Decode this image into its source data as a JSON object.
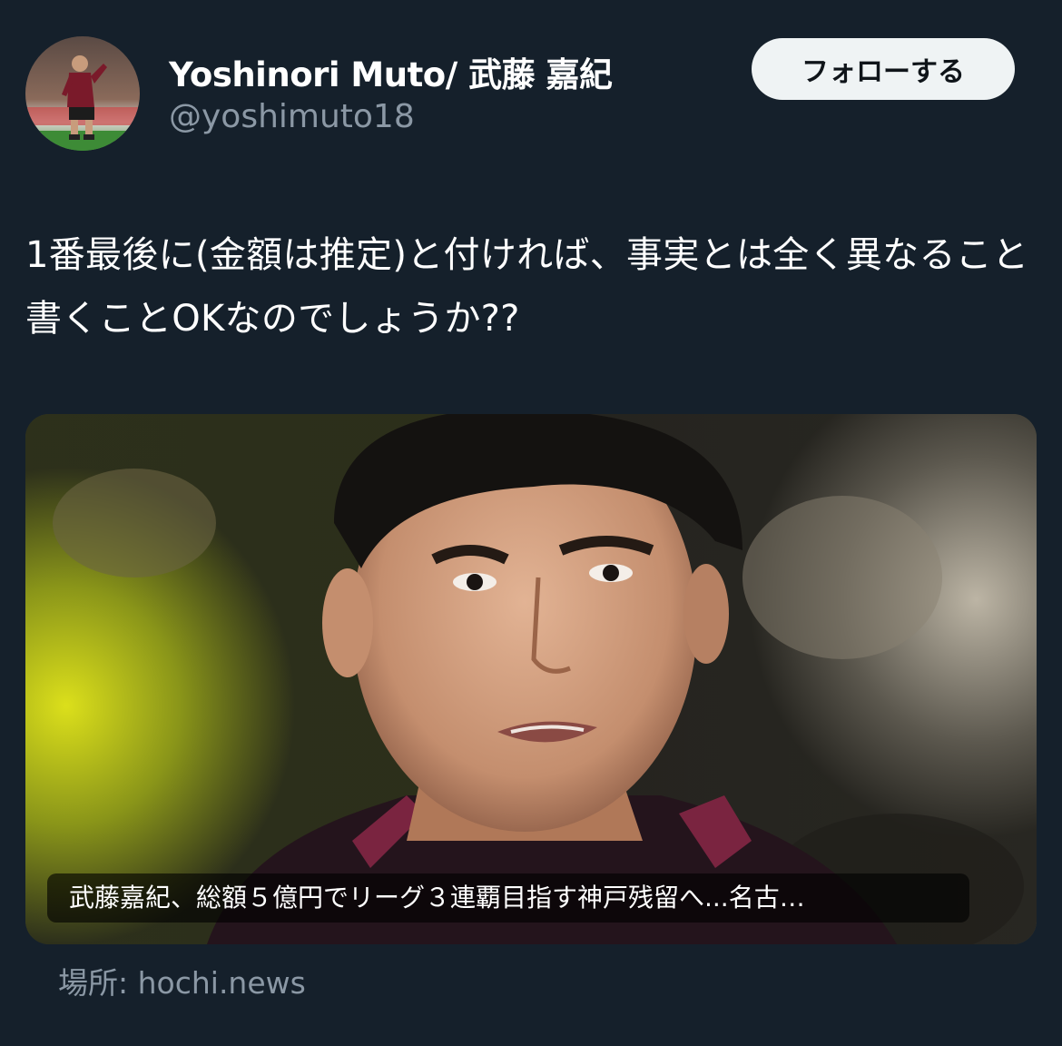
{
  "user": {
    "display_name": "Yoshinori Muto/ 武藤 嘉紀",
    "handle": "@yoshimuto18",
    "follow_label": "フォローする"
  },
  "tweet": {
    "text": "1番最後に(金額は推定)と付ければ、事実とは全く異なること書くことOKなのでしょうか??"
  },
  "card": {
    "caption": "武藤嘉紀、総額５億円でリーグ３連覇目指す神戸残留へ...名古…",
    "source": "場所: hochi.news"
  },
  "colors": {
    "background": "#15202b",
    "secondary_text": "#8b98a5",
    "follow_button_bg": "#eff3f4",
    "follow_button_text": "#0f1419"
  },
  "icons": {
    "avatar": "profile-photo-avatar",
    "card_image": "news-photo-player"
  }
}
